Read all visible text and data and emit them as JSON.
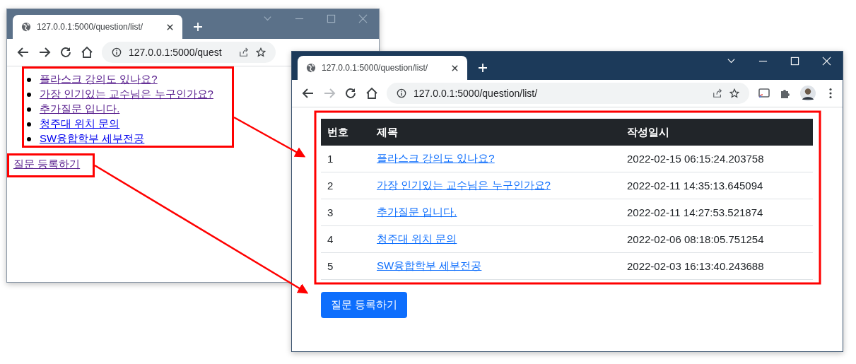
{
  "back_window": {
    "tab_title": "127.0.0.1:5000/question/list/",
    "address": "127.0.0.1:5000/quest",
    "forward_disabled": false,
    "questions": [
      {
        "title": "플라스크 강의도 있나요?",
        "visited": true
      },
      {
        "title": "가장 인기있는 교수님은 누구인가요?",
        "visited": true
      },
      {
        "title": "추가질문 입니다.",
        "visited": true
      },
      {
        "title": "청주대 위치 문의",
        "visited": false
      },
      {
        "title": "SW융합학부 세부전공",
        "visited": false
      }
    ],
    "register_link": {
      "label": "질문 등록하기",
      "visited": true
    }
  },
  "front_window": {
    "tab_title": "127.0.0.1:5000/question/list/",
    "address": "127.0.0.1:5000/question/list/",
    "forward_disabled": true,
    "table": {
      "columns": [
        "번호",
        "제목",
        "작성일시"
      ],
      "rows": [
        {
          "number": "1",
          "title": "플라스크 강의도 있나요?",
          "created": "2022-02-15 06:15:24.203758"
        },
        {
          "number": "2",
          "title": "가장 인기있는 교수님은 누구인가요?",
          "created": "2022-02-11 14:35:13.645094"
        },
        {
          "number": "3",
          "title": "추가질문 입니다.",
          "created": "2022-02-11 14:27:53.521874"
        },
        {
          "number": "4",
          "title": "청주대 위치 문의",
          "created": "2022-02-06 08:18:05.751254"
        },
        {
          "number": "5",
          "title": "SW융합학부 세부전공",
          "created": "2022-02-03 16:13:40.243688"
        }
      ]
    },
    "register_button": "질문 등록하기"
  }
}
